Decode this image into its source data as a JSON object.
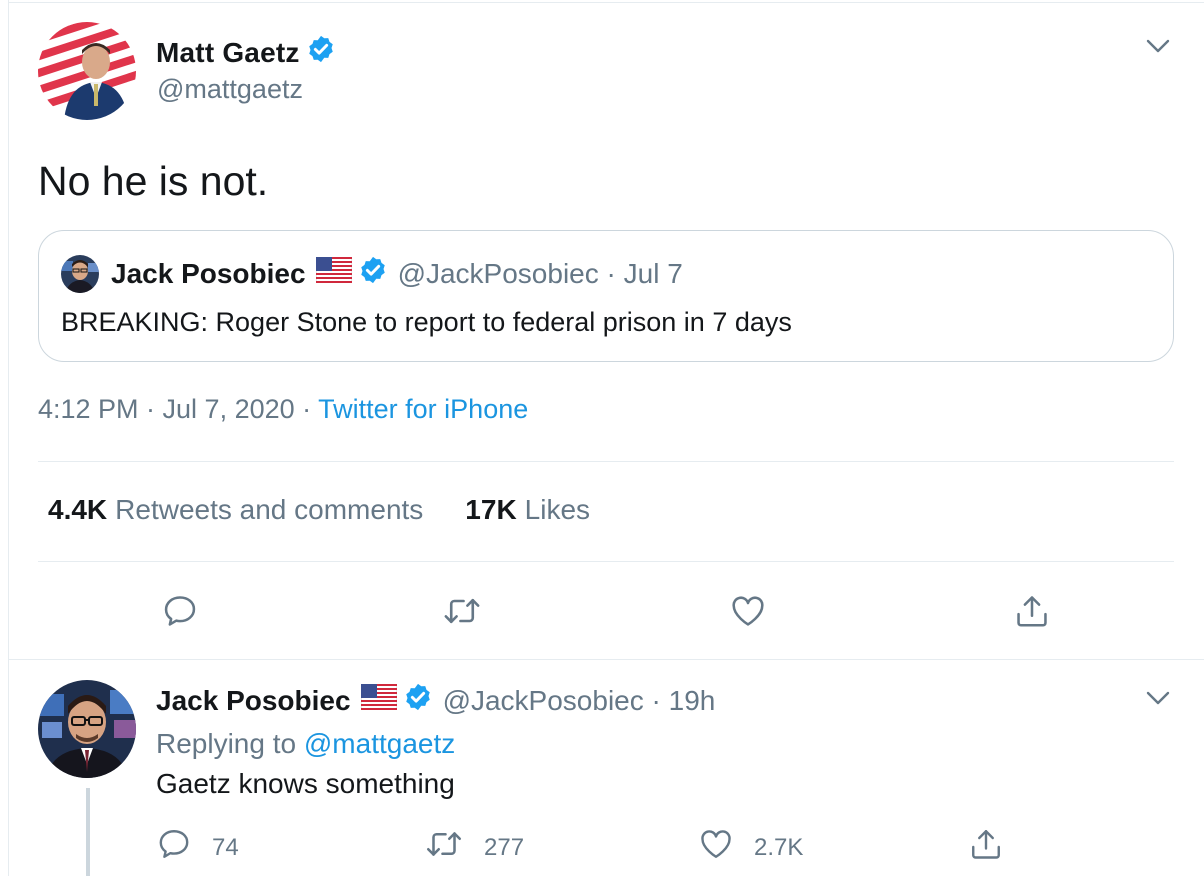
{
  "tweet": {
    "author_name": "Matt Gaetz",
    "author_handle": "@mattgaetz",
    "text": "No he is not.",
    "time": "4:12 PM · Jul 7, 2020 · ",
    "source": "Twitter for iPhone",
    "retweets_count": "4.4K",
    "retweets_label": "Retweets and comments",
    "likes_count": "17K",
    "likes_label": "Likes"
  },
  "quote": {
    "author_name": "Jack Posobiec",
    "author_handle": "@JackPosobiec · Jul 7",
    "text": "BREAKING: Roger Stone to report to federal prison in 7 days"
  },
  "reply": {
    "author_name": "Jack Posobiec",
    "author_handle": "@JackPosobiec · 19h",
    "replying_prefix": "Replying to ",
    "replying_to": "@mattgaetz",
    "text": "Gaetz knows something",
    "reply_count": "74",
    "retweet_count": "277",
    "like_count": "2.7K"
  },
  "icons": {
    "verified": "verified-badge-icon",
    "flag": "us-flag-icon",
    "more": "chevron-down-icon",
    "reply": "reply-icon",
    "retweet": "retweet-icon",
    "like": "heart-icon",
    "share": "share-icon"
  },
  "colors": {
    "accent": "#1b95e0",
    "verified": "#1da1f2",
    "secondary_text": "#657786",
    "border": "#e6ecf0"
  }
}
